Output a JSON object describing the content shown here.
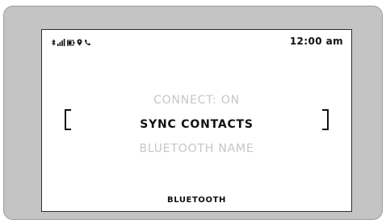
{
  "status_bar": {
    "icons": [
      "bluetooth-icon",
      "signal-icon",
      "battery-icon",
      "gps-icon",
      "phone-icon"
    ],
    "time": "12:00 am"
  },
  "menu": {
    "items": [
      {
        "label": "CONNECT: ON",
        "selected": false
      },
      {
        "label": "SYNC CONTACTS",
        "selected": true
      },
      {
        "label": "BLUETOOTH NAME",
        "selected": false
      }
    ]
  },
  "screen": {
    "title": "BLUETOOTH"
  },
  "colors": {
    "bezel": "#c4c4c4",
    "screen_bg": "#ffffff",
    "text_active": "#111111",
    "text_dim": "#c6c6c6"
  }
}
